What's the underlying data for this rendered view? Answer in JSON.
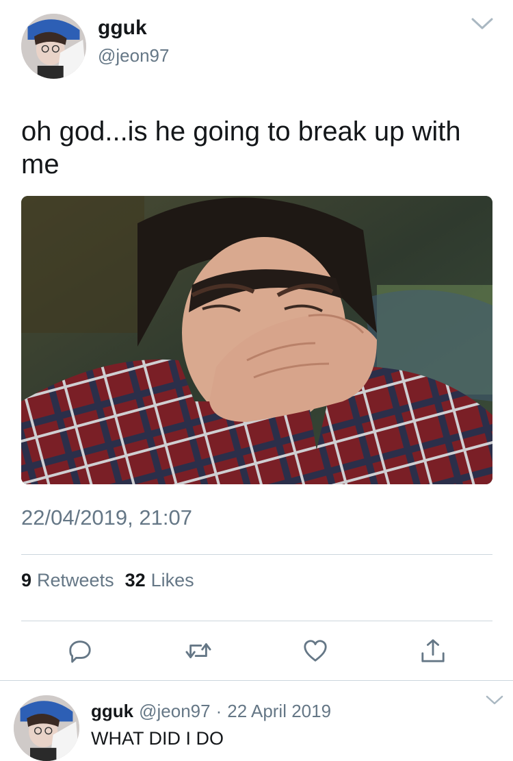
{
  "tweet": {
    "display_name": "gguk",
    "handle": "@jeon97",
    "text": "oh god...is he going to break up with me",
    "timestamp": "22/04/2019, 21:07",
    "retweets_count": "9",
    "retweets_label": "Retweets",
    "likes_count": "32",
    "likes_label": "Likes"
  },
  "reply": {
    "display_name": "gguk",
    "handle": "@jeon97",
    "separator": "·",
    "date": "22 April 2019",
    "text": "WHAT DID I DO"
  },
  "colors": {
    "text_primary": "#14171a",
    "text_secondary": "#657786",
    "divider": "#ccd6dd",
    "icon": "#657786"
  },
  "icons": {
    "caret": "chevron-down-icon",
    "reply": "reply-icon",
    "retweet": "retweet-icon",
    "like": "heart-icon",
    "share": "share-icon"
  }
}
